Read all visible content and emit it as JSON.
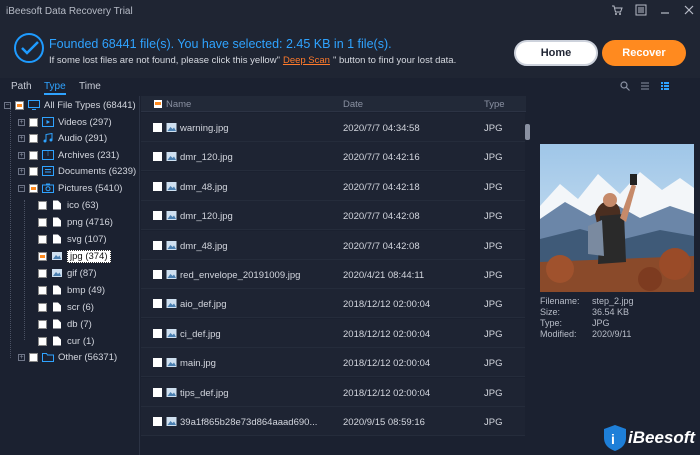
{
  "window": {
    "title": "iBeesoft Data Recovery Trial",
    "controls": [
      "cart-icon",
      "menu-icon",
      "minimize-icon",
      "close-icon"
    ]
  },
  "header": {
    "status": "Founded 68441 file(s).  You have selected: 2.45 KB in 1 file(s).",
    "hint_before": "If some lost files are not found, please click this yellow\"",
    "hint_link": "Deep Scan",
    "hint_after": "\" button to find your lost data.",
    "home_label": "Home",
    "recover_label": "Recover"
  },
  "tabs": [
    {
      "label": "Path",
      "active": false
    },
    {
      "label": "Type",
      "active": true
    },
    {
      "label": "Time",
      "active": false
    }
  ],
  "tree": {
    "root": "All File Types (68441)",
    "videos": "Videos (297)",
    "audio": "Audio (291)",
    "archives": "Archives (231)",
    "documents": "Documents (6239)",
    "pictures": "Pictures (5410)",
    "ico": "ico (63)",
    "png": "png (4716)",
    "svg": "svg (107)",
    "jpg": "jpg (374)",
    "gif": "gif (87)",
    "bmp": "bmp (49)",
    "scr": "scr (6)",
    "db": "db (7)",
    "cur": "cur (1)",
    "other": "Other (56371)"
  },
  "list": {
    "columns": {
      "name": "Name",
      "date": "Date",
      "type": "Type"
    },
    "rows": [
      {
        "name": "warning.jpg",
        "date": "2020/7/7   04:34:58",
        "type": "JPG"
      },
      {
        "name": "dmr_120.jpg",
        "date": "2020/7/7   04:42:16",
        "type": "JPG"
      },
      {
        "name": "dmr_48.jpg",
        "date": "2020/7/7   04:42:18",
        "type": "JPG"
      },
      {
        "name": "dmr_120.jpg",
        "date": "2020/7/7   04:42:08",
        "type": "JPG"
      },
      {
        "name": "dmr_48.jpg",
        "date": "2020/7/7   04:42:08",
        "type": "JPG"
      },
      {
        "name": "red_envelope_20191009.jpg",
        "date": "2020/4/21    08:44:11",
        "type": "JPG"
      },
      {
        "name": "aio_def.jpg",
        "date": "2018/12/12  02:00:04",
        "type": "JPG"
      },
      {
        "name": "ci_def.jpg",
        "date": "2018/12/12  02:00:04",
        "type": "JPG"
      },
      {
        "name": "main.jpg",
        "date": "2018/12/12  02:00:04",
        "type": "JPG"
      },
      {
        "name": "tips_def.jpg",
        "date": "2018/12/12  02:00:04",
        "type": "JPG"
      },
      {
        "name": "39a1f865b28e73d864aaad690...",
        "date": "2020/9/15  08:59:16",
        "type": "JPG"
      }
    ]
  },
  "preview": {
    "filename_label": "Filename:",
    "filename": "step_2.jpg",
    "size_label": "Size:",
    "size": "36.54 KB",
    "type_label": "Type:",
    "type": "JPG",
    "modified_label": "Modified:",
    "modified": "2020/9/11"
  },
  "logo": {
    "text": "iBeesoft"
  },
  "colors": {
    "accent": "#1e9bff",
    "recover": "#ff8a1f",
    "link": "#ff7a2b",
    "background": "#1b2130"
  }
}
